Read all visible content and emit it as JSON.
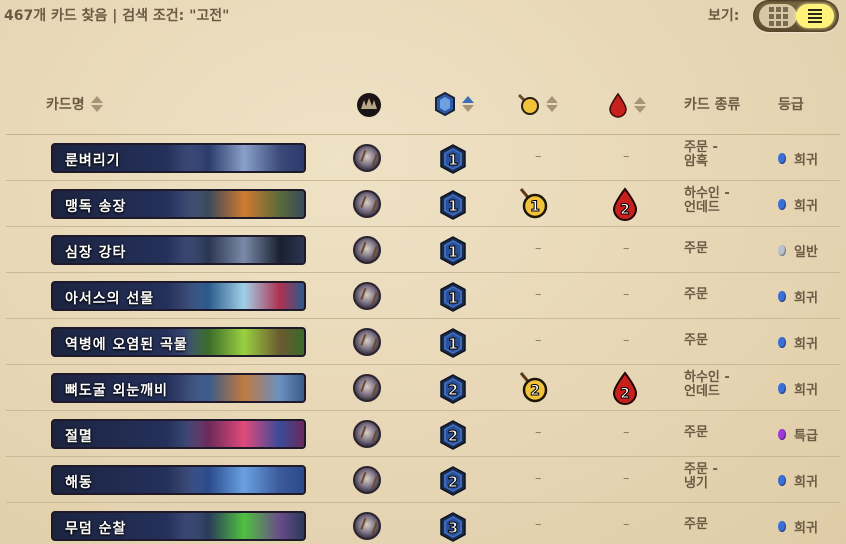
{
  "toolbar": {
    "summary": "467개 카드 찾음 | 검색 조건: \"고전\"",
    "view_label": "보기:",
    "view_options": [
      "grid",
      "list"
    ],
    "active_view": "list"
  },
  "columns": {
    "name": "카드명",
    "class_icon": "class-icon",
    "cost_icon": "mana-icon",
    "attack_icon": "attack-icon",
    "health_icon": "health-icon",
    "type": "카드 종류",
    "rarity": "등급"
  },
  "rarity_colors": {
    "희귀": "#3a6fd8",
    "일반": "#b8c4cc",
    "특급": "#9b3ad8"
  },
  "cards": [
    {
      "name": "룬벼리기",
      "cost": "1",
      "attack": "–",
      "health": "–",
      "type": "주문 -\n암흑",
      "rarity": "희귀",
      "art": [
        "#2a3a6a",
        "#8aa0c8",
        "#3a4a7a"
      ]
    },
    {
      "name": "맹독 송장",
      "cost": "1",
      "attack": "1",
      "health": "2",
      "type": "하수인 -\n언데드",
      "rarity": "희귀",
      "art": [
        "#3a4a5a",
        "#d07a30",
        "#5a6a3a"
      ]
    },
    {
      "name": "심장 강타",
      "cost": "1",
      "attack": "–",
      "health": "–",
      "type": "주문",
      "rarity": "일반",
      "art": [
        "#2a3550",
        "#7a8aa8",
        "#1a2030"
      ]
    },
    {
      "name": "아서스의 선물",
      "cost": "1",
      "attack": "–",
      "health": "–",
      "type": "주문",
      "rarity": "희귀",
      "art": [
        "#2a5a8a",
        "#a0d0e8",
        "#b03050"
      ]
    },
    {
      "name": "역병에 오염된 곡물",
      "cost": "1",
      "attack": "–",
      "health": "–",
      "type": "주문",
      "rarity": "희귀",
      "art": [
        "#3a6a2a",
        "#9ad040",
        "#6a5a30"
      ]
    },
    {
      "name": "뼈도굴 외눈깨비",
      "cost": "2",
      "attack": "2",
      "health": "2",
      "type": "하수인 -\n언데드",
      "rarity": "희귀",
      "art": [
        "#3a5a8a",
        "#c07a40",
        "#6a90c0"
      ]
    },
    {
      "name": "절멸",
      "cost": "2",
      "attack": "–",
      "health": "–",
      "type": "주문",
      "rarity": "특급",
      "art": [
        "#6a2a5a",
        "#e04a7a",
        "#3a4a9a"
      ]
    },
    {
      "name": "해동",
      "cost": "2",
      "attack": "–",
      "health": "–",
      "type": "주문 -\n냉기",
      "rarity": "희귀",
      "art": [
        "#2a4a8a",
        "#6aa0e0",
        "#3a5a9a"
      ]
    },
    {
      "name": "무덤 순찰",
      "cost": "3",
      "attack": "–",
      "health": "–",
      "type": "주문",
      "rarity": "희귀",
      "art": [
        "#2a3a5a",
        "#50c040",
        "#6a4a8a"
      ]
    }
  ]
}
